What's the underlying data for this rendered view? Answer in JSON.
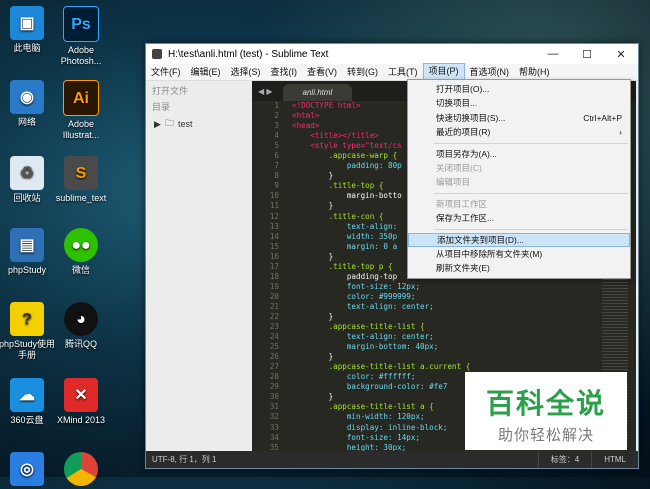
{
  "desktop": {
    "icons": [
      {
        "label": "此电脑"
      },
      {
        "label": "Adobe Photosh..."
      },
      {
        "label": "网络"
      },
      {
        "label": "Adobe Illustrat..."
      },
      {
        "label": "回收站"
      },
      {
        "label": "sublime_text"
      },
      {
        "label": "phpStudy"
      },
      {
        "label": "微信"
      },
      {
        "label": "phpStudy使用手册"
      },
      {
        "label": "腾讯QQ"
      },
      {
        "label": "360云盘"
      },
      {
        "label": "XMind 2013"
      }
    ],
    "ps_glyph": "Ps",
    "ai_glyph": "Ai"
  },
  "window": {
    "title": "H:\\test\\anli.html (test) - Sublime Text",
    "controls": {
      "min": "—",
      "max": "☐",
      "close": "✕"
    }
  },
  "menubar": {
    "items": [
      "文件(F)",
      "编辑(E)",
      "选择(S)",
      "查找(I)",
      "查看(V)",
      "转到(G)",
      "工具(T)",
      "项目(P)",
      "首选项(N)",
      "帮助(H)"
    ]
  },
  "sidebar": {
    "open_files": "打开文件",
    "folders": "目录",
    "folder_name": "test"
  },
  "tab": {
    "label": "anli.html"
  },
  "code_lines": [
    {
      "n": "1",
      "text": "<!DOCTYPE html>"
    },
    {
      "n": "2",
      "text": "<html>"
    },
    {
      "n": "3",
      "text": "<head>"
    },
    {
      "n": "4",
      "text": "    <title></title>"
    },
    {
      "n": "5",
      "text": "    <style type=\"text/cs"
    },
    {
      "n": "6",
      "text": "        .appcase-warp {"
    },
    {
      "n": "7",
      "text": "            padding: 80p"
    },
    {
      "n": "8",
      "text": "        }"
    },
    {
      "n": "9",
      "text": "        .title-top {"
    },
    {
      "n": "10",
      "text": "            margin-botto"
    },
    {
      "n": "11",
      "text": "        }"
    },
    {
      "n": "12",
      "text": "        .title-con {"
    },
    {
      "n": "13",
      "text": "            text-align:"
    },
    {
      "n": "14",
      "text": "            width: 350p"
    },
    {
      "n": "15",
      "text": "            margin: 0 a"
    },
    {
      "n": "16",
      "text": "        }"
    },
    {
      "n": "17",
      "text": "        .title-top p {"
    },
    {
      "n": "18",
      "text": "            padding-top"
    },
    {
      "n": "19",
      "text": "            font-size: 12px;"
    },
    {
      "n": "20",
      "text": "            color: #999999;"
    },
    {
      "n": "21",
      "text": "            text-align: center;"
    },
    {
      "n": "22",
      "text": "        }"
    },
    {
      "n": "23",
      "text": "        .appcase-title-list {"
    },
    {
      "n": "24",
      "text": "            text-align: center;"
    },
    {
      "n": "25",
      "text": "            margin-bottom: 40px;"
    },
    {
      "n": "26",
      "text": "        }"
    },
    {
      "n": "27",
      "text": "        .appcase-title-list a.current {"
    },
    {
      "n": "28",
      "text": "            color: #ffffff;"
    },
    {
      "n": "29",
      "text": "            background-color: #fe7"
    },
    {
      "n": "30",
      "text": "        }"
    },
    {
      "n": "31",
      "text": "        .appcase-title-list a {"
    },
    {
      "n": "32",
      "text": "            min-width: 120px;"
    },
    {
      "n": "33",
      "text": "            display: inline-block;"
    },
    {
      "n": "34",
      "text": "            font-size: 14px;"
    },
    {
      "n": "35",
      "text": "            height: 30px;"
    }
  ],
  "dropdown": {
    "items": [
      {
        "label": "打开项目(O)...",
        "shortcut": "",
        "disabled": false
      },
      {
        "label": "切换项目...",
        "shortcut": "",
        "disabled": false
      },
      {
        "label": "快速切换项目(S)...",
        "shortcut": "Ctrl+Alt+P",
        "disabled": false
      },
      {
        "label": "最近的项目(R)",
        "shortcut": "›",
        "disabled": false
      },
      {
        "sep": true
      },
      {
        "label": "项目另存为(A)...",
        "shortcut": "",
        "disabled": false
      },
      {
        "label": "关闭项目(C)",
        "shortcut": "",
        "disabled": true
      },
      {
        "label": "编辑项目",
        "shortcut": "",
        "disabled": true
      },
      {
        "sep": true
      },
      {
        "label": "新项目工作区",
        "shortcut": "",
        "disabled": true
      },
      {
        "label": "保存为工作区...",
        "shortcut": "",
        "disabled": false
      },
      {
        "sep": true
      },
      {
        "label": "添加文件夹到项目(D)...",
        "shortcut": "",
        "disabled": false,
        "highlight": true
      },
      {
        "label": "从项目中移除所有文件夹(M)",
        "shortcut": "",
        "disabled": false
      },
      {
        "label": "刷新文件夹(E)",
        "shortcut": "",
        "disabled": false
      }
    ]
  },
  "statusbar": {
    "position": "UTF-8, 行 1，列 1",
    "tab_size": "标签：4",
    "syntax": "HTML"
  },
  "watermark": {
    "title": "百科全说",
    "subtitle": "助你轻松解决"
  },
  "colors": {
    "editor_bg": "#272822",
    "highlight": "#cce4f7",
    "watermark_green": "#2aa04a"
  }
}
